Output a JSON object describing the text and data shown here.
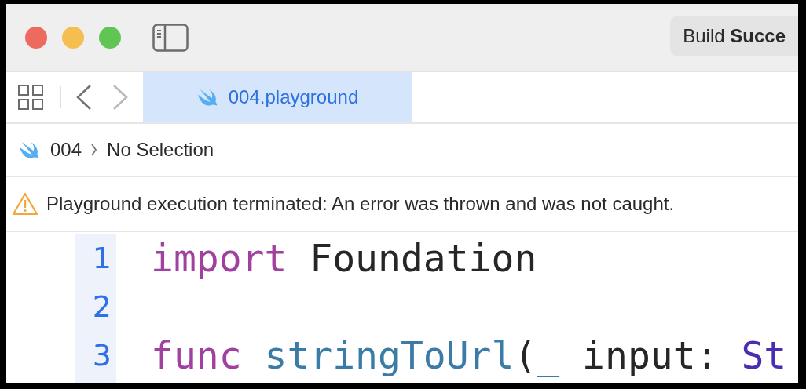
{
  "window": {
    "traffic_lights": [
      {
        "color": "#ed6a5e"
      },
      {
        "color": "#f5bf4f"
      },
      {
        "color": "#61c554"
      }
    ],
    "build_status": "Build **Succe**"
  },
  "navigation": {
    "back": {
      "disabled": false
    },
    "forward": {
      "disabled": true
    }
  },
  "tabs": [
    {
      "label": "004.playground",
      "selected": true
    }
  ],
  "breadcrumb": [
    {
      "label": "004",
      "kind": "swift"
    },
    {
      "label": "No Selection",
      "kind": "plain"
    }
  ],
  "warning": {
    "message": "Playground execution terminated: An error was thrown and was not caught."
  },
  "editor": {
    "lines": [
      {
        "number": "1",
        "tokens": [
          {
            "text": "import",
            "kind": "keyword"
          },
          {
            "text": " Foundation",
            "kind": "plain"
          }
        ]
      },
      {
        "number": "2"
      },
      {
        "number": "3",
        "tokens": [
          {
            "text": "func",
            "kind": "keyword"
          },
          {
            "text": " stringToUrl",
            "kind": "function"
          },
          {
            "text": "(",
            "kind": "plain"
          },
          {
            "text": "_",
            "kind": "function"
          },
          {
            "text": " input: ",
            "kind": "plain"
          },
          {
            "text": "St",
            "kind": "type"
          }
        ]
      }
    ]
  }
}
